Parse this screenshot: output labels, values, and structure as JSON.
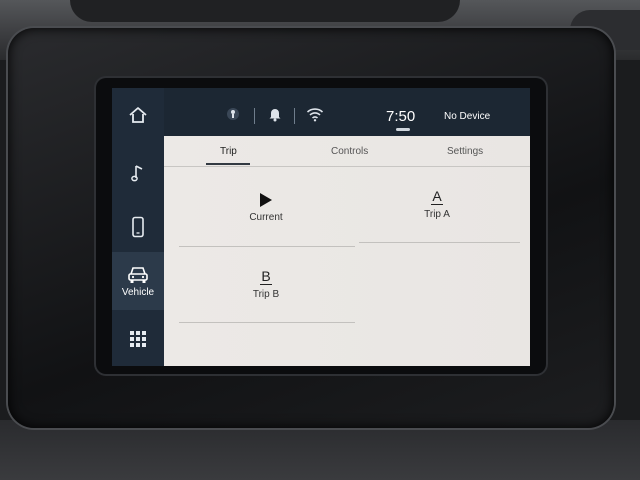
{
  "sidebar": {
    "items": [
      {
        "name": "home",
        "icon": "home-icon"
      },
      {
        "name": "media",
        "icon": "music-note-icon"
      },
      {
        "name": "phone",
        "icon": "phone-icon"
      },
      {
        "name": "vehicle",
        "icon": "car-icon",
        "label": "Vehicle",
        "active": true
      },
      {
        "name": "apps",
        "icon": "grid-icon"
      }
    ]
  },
  "statusbar": {
    "time": "7:50",
    "device": "No Device",
    "icons": [
      "driver-icon",
      "bell-icon",
      "wifi-icon"
    ]
  },
  "tabs": [
    {
      "label": "Trip",
      "active": true
    },
    {
      "label": "Controls",
      "active": false
    },
    {
      "label": "Settings",
      "active": false
    }
  ],
  "trip_items": [
    {
      "label": "Current",
      "icon": "play-icon"
    },
    {
      "label": "Trip A",
      "icon_letter": "A"
    },
    {
      "label": "Trip B",
      "icon_letter": "B"
    }
  ],
  "colors": {
    "sidebar_bg": "#1f2b39",
    "content_bg": "#ece9e6",
    "active_tab_text": "#222222"
  }
}
